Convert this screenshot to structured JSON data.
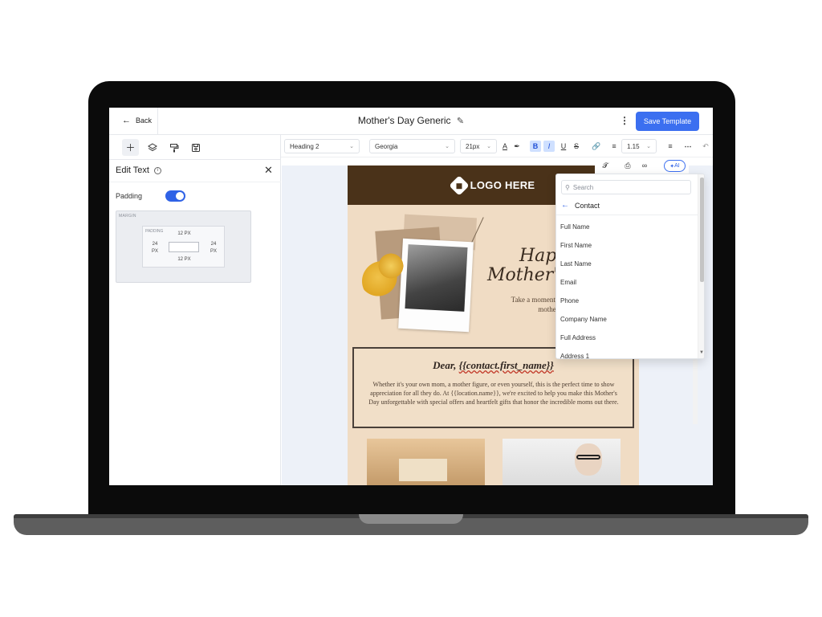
{
  "header": {
    "back_label": "Back",
    "title": "Mother's Day Generic",
    "save_label": "Save Template"
  },
  "left_panel": {
    "title": "Edit Text",
    "padding_label": "Padding",
    "padding_enabled": true,
    "margin_label": "MARGIN",
    "padding_box_label": "PADDING",
    "padding_top": "12 PX",
    "padding_bottom": "12 PX",
    "padding_left_value": "24",
    "padding_left_unit": "PX",
    "padding_right_value": "24",
    "padding_right_unit": "PX"
  },
  "toolbar": {
    "block_style": "Heading 2",
    "font_family": "Georgia",
    "font_size": "21px",
    "line_height": "1.15"
  },
  "sub_toolbar": {
    "ai_label": "AI"
  },
  "email": {
    "logo_text": "LOGO HERE",
    "script_line1": "Hap",
    "script_line2": "Mother's",
    "hero_sub": "Take a moment t amazing mother",
    "greeting_prefix": "Dear, ",
    "greeting_merge": "{{contact.first_name}}",
    "body": "Whether it's your own mom, a mother figure, or even yourself, this is the perfect time to show appreciation for all they do. At {{location.name}}, we're excited to help you make this Mother's Day unforgettable with special offers and heartfelt gifts that honor the incredible moms out there."
  },
  "dropdown": {
    "search_placeholder": "Search",
    "back_label": "Contact",
    "items": [
      "Full Name",
      "First Name",
      "Last Name",
      "Email",
      "Phone",
      "Company Name",
      "Full Address",
      "Address 1"
    ]
  },
  "colors": {
    "accent": "#3b6ff0",
    "email_header": "#4a3219",
    "email_bg": "#f0dcc4"
  }
}
